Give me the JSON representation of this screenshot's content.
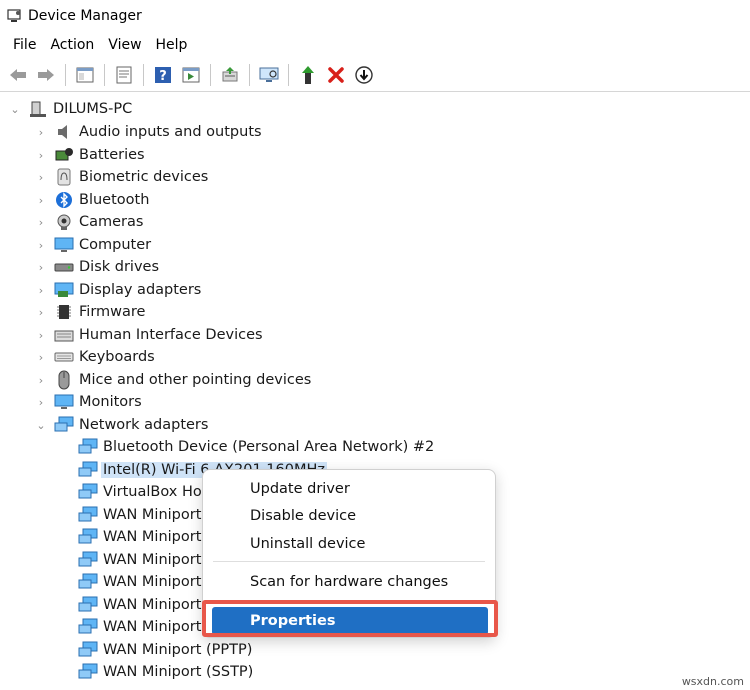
{
  "window": {
    "title": "Device Manager"
  },
  "menu": [
    "File",
    "Action",
    "View",
    "Help"
  ],
  "tree": {
    "root": "DILUMS-PC",
    "categories": [
      "Audio inputs and outputs",
      "Batteries",
      "Biometric devices",
      "Bluetooth",
      "Cameras",
      "Computer",
      "Disk drives",
      "Display adapters",
      "Firmware",
      "Human Interface Devices",
      "Keyboards",
      "Mice and other pointing devices",
      "Monitors",
      "Network adapters"
    ],
    "network_children": [
      "Bluetooth Device (Personal Area Network) #2",
      "Intel(R) Wi-Fi 6 AX201 160MHz",
      "VirtualBox Host",
      "WAN Miniport",
      "WAN Miniport",
      "WAN Miniport",
      "WAN Miniport",
      "WAN Miniport",
      "WAN Miniport",
      "WAN Miniport (PPTP)",
      "WAN Miniport (SSTP)"
    ]
  },
  "context_menu": {
    "items": [
      "Update driver",
      "Disable device",
      "Uninstall device",
      "Scan for hardware changes",
      "Properties"
    ],
    "highlight_color": "#e8574a",
    "active_color": "#1f6fc4"
  },
  "watermark": "wsxdn.com"
}
